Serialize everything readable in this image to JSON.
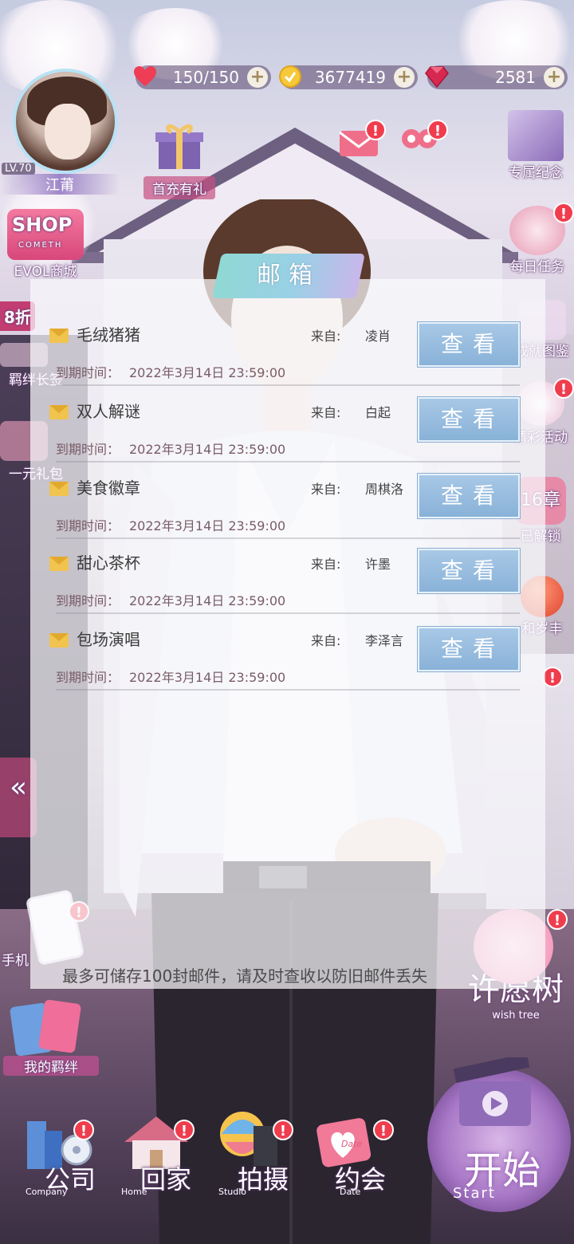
{
  "resources": {
    "hearts": "150/150",
    "gold": "3677419",
    "gems": "2581",
    "plus": "+"
  },
  "player": {
    "level": "LV.70",
    "name": "江莆"
  },
  "left_buttons": {
    "first_charge": "首充有礼",
    "shop_logo": "SHOP",
    "shop_sub": "COMETH",
    "shop": "EVOL商城",
    "discount": "8折",
    "bond_label": "羁绊长签",
    "one_yuan": "一元礼包",
    "back_arrow": "«",
    "phone": "手机",
    "my_bonds": "我的羁绊"
  },
  "right_buttons": {
    "exclusive": "专属纪念",
    "daily": "每日任务",
    "achievement": "成就图鉴",
    "event": "精彩活动",
    "chapter": "16章",
    "unlocked": "已解锁",
    "harvest": "和岁丰",
    "wish_tree_cn": "许愿树",
    "wish_tree_en": "wish tree"
  },
  "mailbox": {
    "title": "邮箱",
    "from_label": "来自:",
    "expire_label": "到期时间：",
    "view_label": "查看",
    "items": [
      {
        "subject": "毛绒猪猪",
        "from": "凌肖",
        "expires": "2022年3月14日 23:59:00"
      },
      {
        "subject": "双人解谜",
        "from": "白起",
        "expires": "2022年3月14日 23:59:00"
      },
      {
        "subject": "美食徽章",
        "from": "周棋洛",
        "expires": "2022年3月14日 23:59:00"
      },
      {
        "subject": "甜心茶杯",
        "from": "许墨",
        "expires": "2022年3月14日 23:59:00"
      },
      {
        "subject": "包场演唱",
        "from": "李泽言",
        "expires": "2022年3月14日 23:59:00"
      }
    ],
    "note": "最多可储存100封邮件，请及时查收以防旧邮件丢失"
  },
  "bottom_nav": [
    {
      "cn": "公司",
      "en": "Company"
    },
    {
      "cn": "回家",
      "en": "Home"
    },
    {
      "cn": "拍摄",
      "en": "Studio"
    },
    {
      "cn": "约会",
      "en": "Date"
    }
  ],
  "start": {
    "cn": "开始",
    "en": "Start"
  },
  "badge": "!",
  "date_tag": "Date",
  "colors": {
    "badge": "#ef3d4e",
    "view_button": "#89b2d8",
    "title_ribbon": "#9ad0e6",
    "expire_text": "#7a5c66"
  }
}
